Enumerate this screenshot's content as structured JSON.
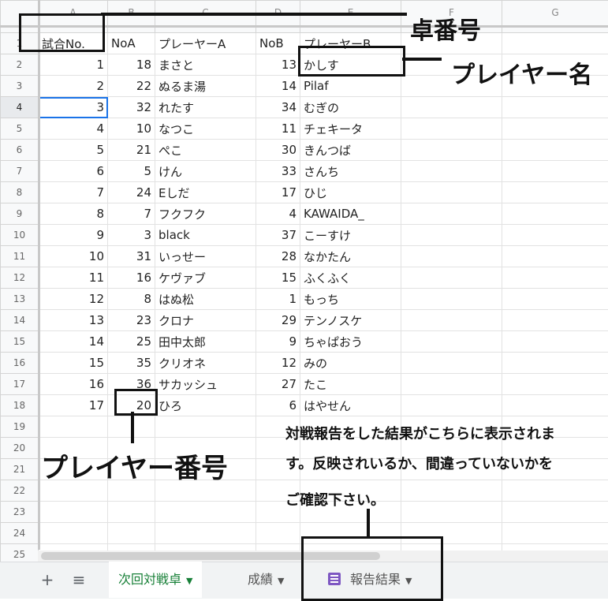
{
  "columns": [
    "A",
    "B",
    "C",
    "D",
    "E",
    "F",
    "G"
  ],
  "header_row": {
    "a": "試合No.",
    "b": "NoA",
    "c": "プレーヤーA",
    "d": "NoB",
    "e": "プレーヤーB"
  },
  "rows": [
    {
      "n": "2",
      "a": "1",
      "b": "18",
      "c": "まさと",
      "d": "13",
      "e": "かしす"
    },
    {
      "n": "3",
      "a": "2",
      "b": "22",
      "c": "ぬるま湯",
      "d": "14",
      "e": "Pilaf"
    },
    {
      "n": "4",
      "a": "3",
      "b": "32",
      "c": "れたす",
      "d": "34",
      "e": "むぎの"
    },
    {
      "n": "5",
      "a": "4",
      "b": "10",
      "c": "なつこ",
      "d": "11",
      "e": "チェキータ"
    },
    {
      "n": "6",
      "a": "5",
      "b": "21",
      "c": "ぺこ",
      "d": "30",
      "e": "きんつば"
    },
    {
      "n": "7",
      "a": "6",
      "b": "5",
      "c": "けん",
      "d": "33",
      "e": "さんち"
    },
    {
      "n": "8",
      "a": "7",
      "b": "24",
      "c": "Eしだ",
      "d": "17",
      "e": "ひじ"
    },
    {
      "n": "9",
      "a": "8",
      "b": "7",
      "c": "フクフク",
      "d": "4",
      "e": "KAWAIDA_"
    },
    {
      "n": "10",
      "a": "9",
      "b": "3",
      "c": "black",
      "d": "37",
      "e": "こーすけ"
    },
    {
      "n": "11",
      "a": "10",
      "b": "31",
      "c": "いっせー",
      "d": "28",
      "e": "なかたん"
    },
    {
      "n": "12",
      "a": "11",
      "b": "16",
      "c": "ケヴァブ",
      "d": "15",
      "e": "ふくふく"
    },
    {
      "n": "13",
      "a": "12",
      "b": "8",
      "c": "はぬ松",
      "d": "1",
      "e": "もっち"
    },
    {
      "n": "14",
      "a": "13",
      "b": "23",
      "c": "クロナ",
      "d": "29",
      "e": "テンノスケ"
    },
    {
      "n": "15",
      "a": "14",
      "b": "25",
      "c": "田中太郎",
      "d": "9",
      "e": "ちゃぱおう"
    },
    {
      "n": "16",
      "a": "15",
      "b": "35",
      "c": "クリオネ",
      "d": "12",
      "e": "みの"
    },
    {
      "n": "17",
      "a": "16",
      "b": "36",
      "c": "サカッシュ",
      "d": "27",
      "e": "たこ"
    },
    {
      "n": "18",
      "a": "17",
      "b": "20",
      "c": "ひろ",
      "d": "6",
      "e": "はやせん"
    }
  ],
  "empty_rows": [
    "19",
    "20",
    "21",
    "22",
    "23",
    "24",
    "25"
  ],
  "annotations": {
    "table_number": "卓番号",
    "player_name": "プレイヤー名",
    "player_number": "プレイヤー番号",
    "note_line1": "対戦報告をした結果がこちらに表示されま",
    "note_line2": "す。反映されいるか、間違っていないかを",
    "note_line3": "ご確認下さい。"
  },
  "tabs": {
    "add": "+",
    "menu": "≡",
    "sheet1": "次回対戦卓",
    "sheet2": "成績",
    "sheet3": "報告結果",
    "caret": "▼"
  },
  "colors": {
    "active_tab": "#188038",
    "selection": "#1a73e8",
    "form_icon": "#7e57c2"
  }
}
